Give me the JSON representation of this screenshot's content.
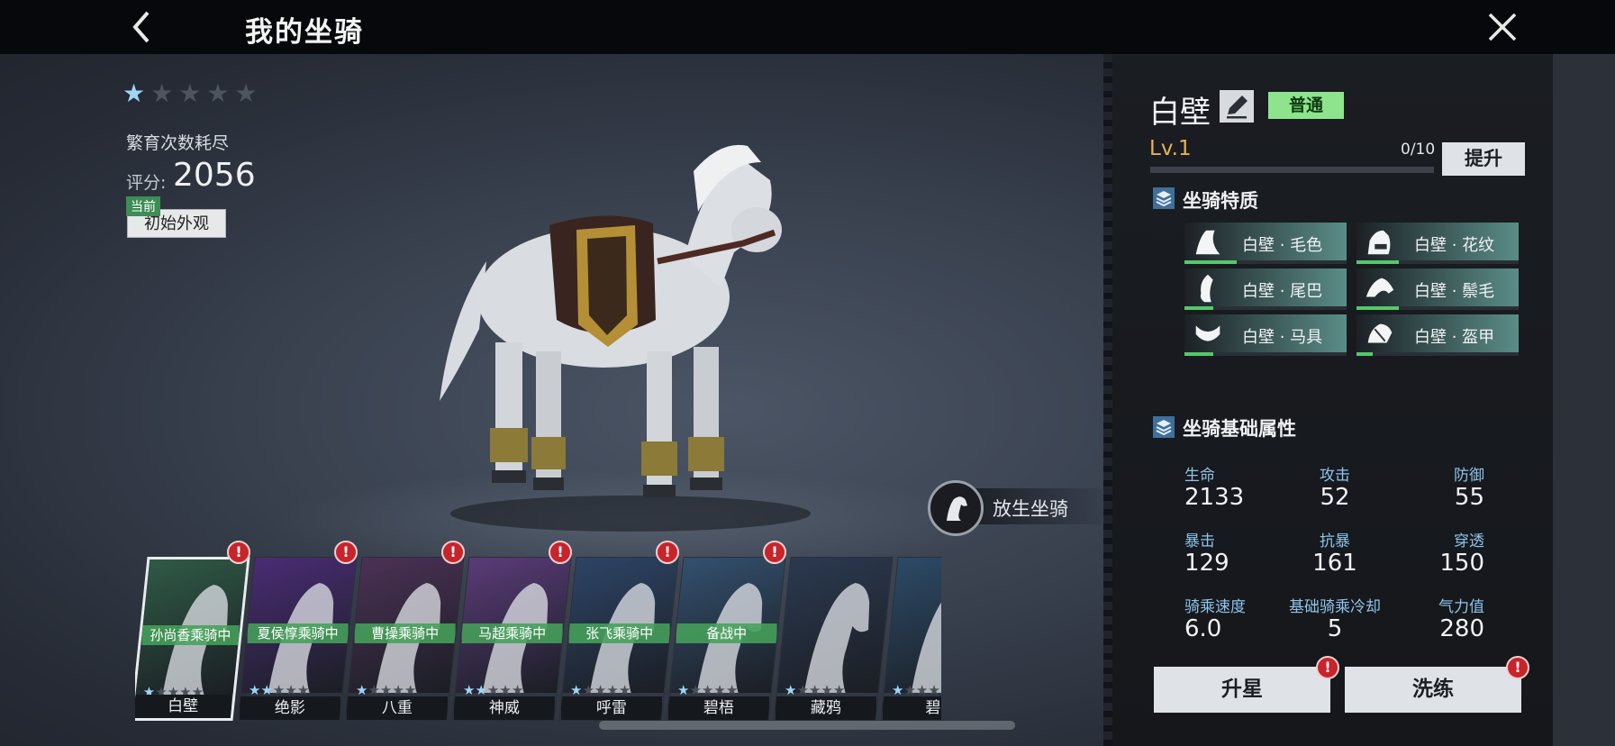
{
  "header": {
    "title": "我的坐骑"
  },
  "mount": {
    "stars_filled": 1,
    "stars_total": 5,
    "breed_status": "繁育次数耗尽",
    "score_label": "评分:",
    "score_value": "2056",
    "current_tag": "当前",
    "skin_button": "初始外观"
  },
  "release": {
    "label": "放生坐骑"
  },
  "stables": [
    {
      "name": "白壁",
      "status": "孙尚香乘骑中",
      "stars": 1,
      "selected": true,
      "alert": true,
      "tint": "#2f5a46"
    },
    {
      "name": "绝影",
      "status": "夏侯惇乘骑中",
      "stars": 2,
      "selected": false,
      "alert": true,
      "tint": "#4a2c74"
    },
    {
      "name": "八重",
      "status": "曹操乘骑中",
      "stars": 1,
      "selected": false,
      "alert": true,
      "tint": "#4b3155"
    },
    {
      "name": "神威",
      "status": "马超乘骑中",
      "stars": 2,
      "selected": false,
      "alert": true,
      "tint": "#5a3b78"
    },
    {
      "name": "呼雷",
      "status": "张飞乘骑中",
      "stars": 1,
      "selected": false,
      "alert": true,
      "tint": "#2d4466"
    },
    {
      "name": "碧梧",
      "status": "备战中",
      "stars": 1,
      "selected": false,
      "alert": true,
      "tint": "#33506e"
    },
    {
      "name": "藏鸦",
      "status": "",
      "stars": 1,
      "selected": false,
      "alert": false,
      "tint": "#2b3950"
    },
    {
      "name": "碧",
      "status": "",
      "stars": 1,
      "selected": false,
      "alert": false,
      "tint": "#2c4a66"
    }
  ],
  "panel": {
    "name": "白壁",
    "rarity": "普通",
    "level": "Lv.1",
    "exp_text": "0/10",
    "exp_fraction": 0,
    "upgrade_label": "提升",
    "traits_title": "坐骑特质",
    "traits": [
      {
        "label": "白壁 · 毛色",
        "progress": 0.32
      },
      {
        "label": "白壁 · 花纹",
        "progress": 0.26
      },
      {
        "label": "白壁 · 尾巴",
        "progress": 0.18
      },
      {
        "label": "白壁 · 鬃毛",
        "progress": 0.26
      },
      {
        "label": "白壁 · 马具",
        "progress": 0.18
      },
      {
        "label": "白壁 · 盔甲",
        "progress": 0.1
      }
    ],
    "attrs_title": "坐骑基础属性",
    "stats": [
      {
        "label": "生命",
        "value": "2133"
      },
      {
        "label": "攻击",
        "value": "52"
      },
      {
        "label": "防御",
        "value": "55"
      },
      {
        "label": "暴击",
        "value": "129"
      },
      {
        "label": "抗暴",
        "value": "161"
      },
      {
        "label": "穿透",
        "value": "150"
      },
      {
        "label": "骑乘速度",
        "value": "6.0"
      },
      {
        "label": "基础骑乘冷却",
        "value": "5"
      },
      {
        "label": "气力值",
        "value": "280"
      }
    ],
    "star_up_label": "升星",
    "refine_label": "洗练"
  },
  "colors": {
    "accent_green": "#54c86a",
    "rarity_green": "#8ee48c",
    "stat_blue": "#8ec4ea",
    "level_gold": "#e5b253",
    "alert_red": "#c8242b"
  }
}
